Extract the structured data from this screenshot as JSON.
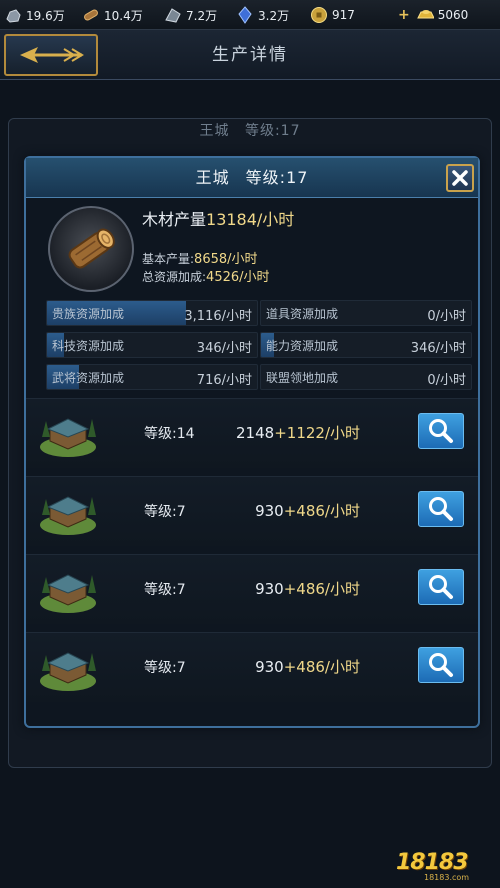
{
  "resources": [
    {
      "icon": "stone-icon",
      "value": "19.6万"
    },
    {
      "icon": "wood-icon",
      "value": "10.4万"
    },
    {
      "icon": "iron-icon",
      "value": "7.2万"
    },
    {
      "icon": "crystal-icon",
      "value": "3.2万"
    },
    {
      "icon": "coin-icon",
      "value": "917"
    },
    {
      "icon": "gold-ingot-icon",
      "value": "5060"
    }
  ],
  "header": {
    "title": "生产详情"
  },
  "background": {
    "city": "王城",
    "level": "等级:17"
  },
  "popup": {
    "city": "王城",
    "level": "等级:17",
    "output_label": "木材产量",
    "output_value": "13184/小时",
    "base_label": "基本产量:",
    "base_value": "8658/小时",
    "total_bonus_label": "总资源加成:",
    "total_bonus_value": "4526/小时",
    "bonuses": [
      {
        "label": "贵族资源加成",
        "value": "3,116/小时",
        "fill": 0.66
      },
      {
        "label": "道具资源加成",
        "value": "0/小时",
        "fill": 0.0
      },
      {
        "label": "科技资源加成",
        "value": "346/小时",
        "fill": 0.08
      },
      {
        "label": "能力资源加成",
        "value": "346/小时",
        "fill": 0.06
      },
      {
        "label": "武将资源加成",
        "value": "716/小时",
        "fill": 0.15
      },
      {
        "label": "联盟领地加成",
        "value": "0/小时",
        "fill": 0.0
      }
    ],
    "buildings": [
      {
        "level": "等级:14",
        "base": "2148",
        "bonus": "+1122/小时"
      },
      {
        "level": "等级:7",
        "base": "930",
        "bonus": "+486/小时"
      },
      {
        "level": "等级:7",
        "base": "930",
        "bonus": "+486/小时"
      },
      {
        "level": "等级:7",
        "base": "930",
        "bonus": "+486/小时"
      }
    ]
  },
  "watermark": {
    "text": "18183",
    "sub": "18183.com"
  }
}
